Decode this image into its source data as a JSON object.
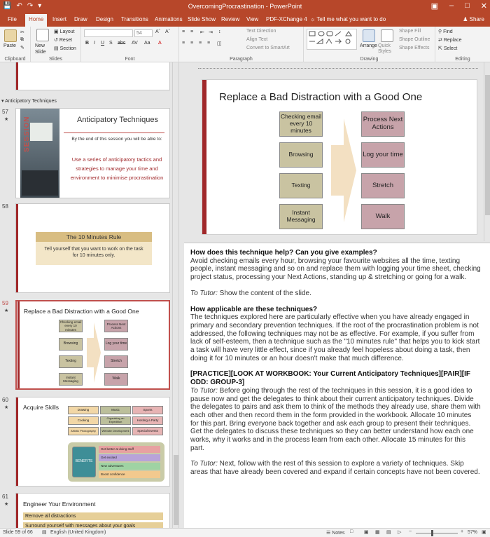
{
  "window": {
    "title": "OvercomingProcrastination - PowerPoint",
    "share_label": "Share"
  },
  "tabs": [
    "File",
    "Home",
    "Insert",
    "Draw",
    "Design",
    "Transitions",
    "Animations",
    "Slide Show",
    "Review",
    "View",
    "PDF-XChange 4"
  ],
  "tell_me": "Tell me what you want to do",
  "ribbon": {
    "clipboard": {
      "label": "Clipboard",
      "paste": "Paste"
    },
    "slides": {
      "label": "Slides",
      "new_slide": "New Slide",
      "layout": "Layout",
      "reset": "Reset",
      "section": "Section"
    },
    "font": {
      "label": "Font",
      "size": "54"
    },
    "paragraph": {
      "label": "Paragraph",
      "text_direction": "Text Direction",
      "align_text": "Align Text",
      "convert": "Convert to SmartArt"
    },
    "drawing": {
      "label": "Drawing",
      "arrange": "Arrange",
      "quick_styles": "Quick Styles",
      "shape_fill": "Shape Fill",
      "shape_outline": "Shape Outline",
      "shape_effects": "Shape Effects"
    },
    "editing": {
      "label": "Editing",
      "find": "Find",
      "replace": "Replace",
      "select": "Select"
    }
  },
  "thumbnails": {
    "section": "Anticipatory Techniques",
    "s57": {
      "num": "57",
      "side_text": "SESSION",
      "title": "Anticipatory Techniques",
      "subtitle": "By the end of this session you will be able to:",
      "body": "Use a series of anticipatory tactics and strategies to manage your time and environment to minimise procrastination"
    },
    "s58": {
      "num": "58",
      "title": "The 10 Minutes Rule",
      "body": "Tell yourself that you want to work on the task for 10 minutes only."
    },
    "s59": {
      "num": "59",
      "title": "Replace a Bad Distraction with a Good One",
      "left": [
        "Checking email every 10 minutes",
        "Browsing",
        "Texting",
        "Instant Messaging"
      ],
      "right": [
        "Process Next Actions",
        "Log your time",
        "Stretch",
        "Walk"
      ]
    },
    "s60": {
      "num": "60",
      "title": "Acquire Skills",
      "grid": [
        "Drawing",
        "Music",
        "Sports",
        "Cooking",
        "Organising an Expedition",
        "Hosting a Party",
        "Artistic Photography",
        "Website Development",
        "Special Events"
      ],
      "benefits_label": "BENEFITS",
      "benefits": [
        "Get better at doing stuff",
        "Get excited",
        "New adventures",
        "Boost confidence"
      ]
    },
    "s61": {
      "num": "61",
      "title": "Engineer Your Environment",
      "items": [
        "Remove all distractions",
        "Surround yourself with messages about your goals"
      ]
    }
  },
  "main_slide": {
    "title": "Replace a Bad Distraction with a Good One",
    "left": [
      "Checking email every 10 minutes",
      "Browsing",
      "Texting",
      "Instant Messaging"
    ],
    "right": [
      "Process Next Actions",
      "Log your time",
      "Stretch",
      "Walk"
    ]
  },
  "notes": {
    "h1": "How does this technique help? Can you give examples?",
    "p1": "Avoid checking emails every hour, browsing your favourite websites all the time, texting people, instant messaging and so on and replace them with logging your time sheet, checking project status, processing your Next Actions, standing up & stretching or going for a walk.",
    "tutor1_label": "To Tutor:",
    "tutor1": " Show the content of the slide.",
    "h2": "How applicable are these techniques?",
    "p2": "The techniques explored here are particularly effective when you have already engaged in primary and secondary prevention techniques. If the root of the procrastination problem is not addressed, the following techniques may not be as effective. For example, if you suffer from lack of self-esteem, then a technique such as the \"10 minutes rule\" that helps you to kick start a task will have very little effect, since if you already feel hopeless about doing a task, then doing it for 10 minutes or an hour doesn't make that much difference.",
    "h3": "[PRACTICE][LOOK AT WORKBOOK: Your Current Anticipatory Techniques][PAIR][IF ODD: GROUP-3]",
    "tutor2_label": "To Tutor:",
    "tutor2": " Before going through the rest of the techniques in this session, it is a good idea to pause now and get the delegates to think about their current anticipatory techniques. Divide the delegates to pairs and ask them to think of the methods they already use, share them with each other and then record them in the form provided in the workbook. Allocate 10 minutes for this part. Bring everyone back together and ask each group to present their techniques. Get the delegates to discuss these techniques so they can better understand how each one works, why it works and in the process learn from each other. Allocate 15 minutes for this part.",
    "tutor3_label": "To Tutor:",
    "tutor3": " Next, follow with the rest of this session to explore a variety of techniques. Skip areas that have already been covered and expand if certain concepts have not been covered."
  },
  "status": {
    "slide": "Slide 59 of 66",
    "language": "English (United Kingdom)",
    "notes": "Notes",
    "zoom": "57%"
  }
}
